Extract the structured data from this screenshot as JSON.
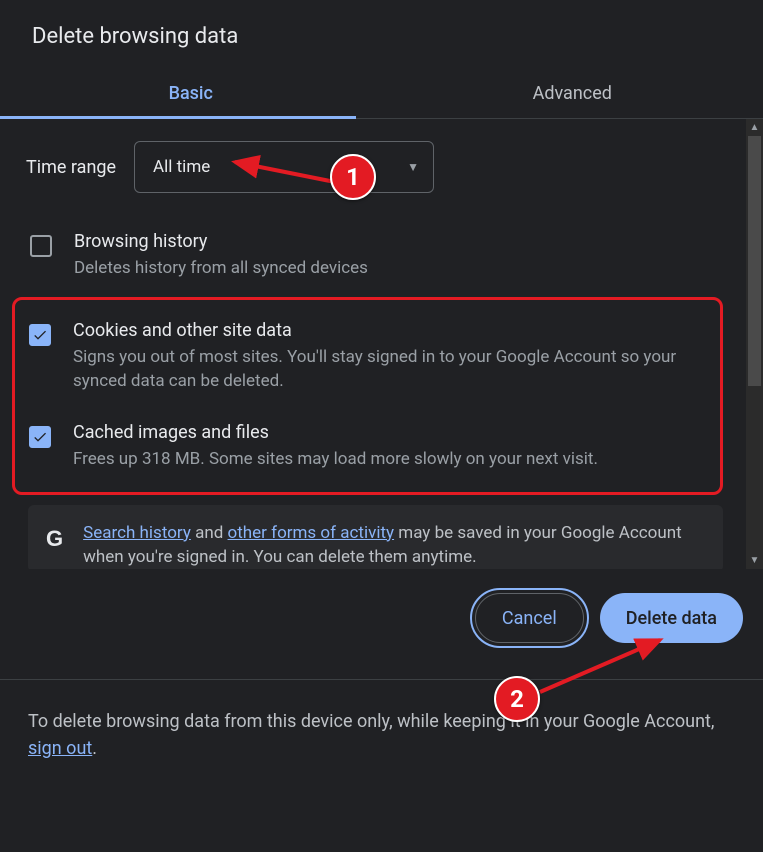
{
  "title": "Delete browsing data",
  "tabs": {
    "basic": "Basic",
    "advanced": "Advanced"
  },
  "timerange": {
    "label": "Time range",
    "value": "All time"
  },
  "options": {
    "history": {
      "title": "Browsing history",
      "sub": "Deletes history from all synced devices",
      "checked": false
    },
    "cookies": {
      "title": "Cookies and other site data",
      "sub": "Signs you out of most sites. You'll stay signed in to your Google Account so your synced data can be deleted.",
      "checked": true
    },
    "cache": {
      "title": "Cached images and files",
      "sub": "Frees up 318 MB. Some sites may load more slowly on your next visit.",
      "checked": true
    }
  },
  "info": {
    "g": "G",
    "link1": "Search history",
    "mid1": " and ",
    "link2": "other forms of activity",
    "rest": " may be saved in your Google Account when you're signed in. You can delete them anytime."
  },
  "buttons": {
    "cancel": "Cancel",
    "delete": "Delete data"
  },
  "note": {
    "text": "To delete browsing data from this device only, while keeping it in your Google Account, ",
    "link": "sign out",
    "after": "."
  },
  "annotations": {
    "one": "1",
    "two": "2"
  }
}
